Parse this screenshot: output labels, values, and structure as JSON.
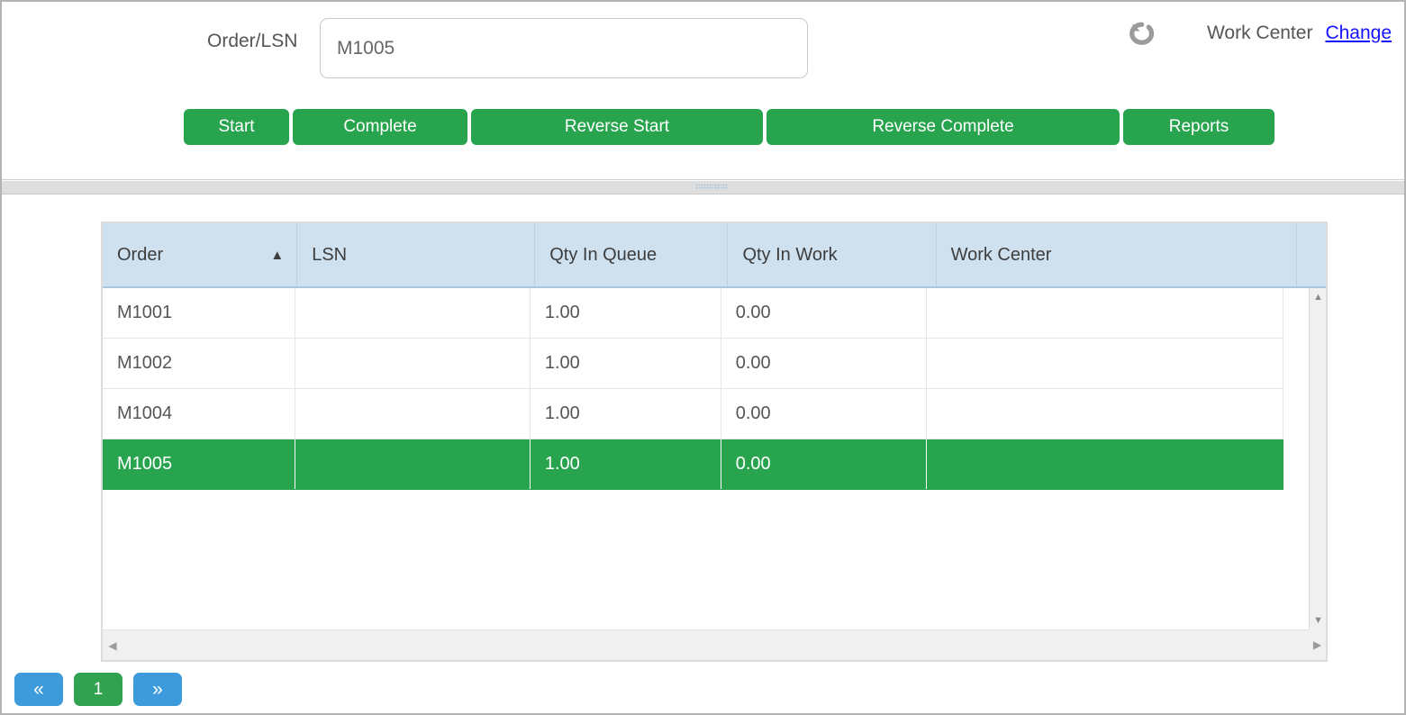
{
  "header": {
    "order_label": "Order/LSN",
    "order_value": "M1005",
    "order_placeholder": "",
    "undo_icon": "undo-arrow-icon",
    "work_center_label": "Work Center",
    "change_link": "Change"
  },
  "actions": {
    "start": "Start",
    "complete": "Complete",
    "reverse_start": "Reverse Start",
    "reverse_complete": "Reverse Complete",
    "reports": "Reports"
  },
  "grid": {
    "columns": [
      {
        "key": "order",
        "label": "Order",
        "sort": "asc"
      },
      {
        "key": "lsn",
        "label": "LSN",
        "sort": ""
      },
      {
        "key": "qty_queue",
        "label": "Qty In Queue",
        "sort": ""
      },
      {
        "key": "qty_work",
        "label": "Qty In Work",
        "sort": ""
      },
      {
        "key": "work_center",
        "label": "Work Center",
        "sort": ""
      },
      {
        "key": "spacer",
        "label": "",
        "sort": ""
      }
    ],
    "sort_caret_asc": "▲",
    "rows": [
      {
        "order": "M1001",
        "lsn": "",
        "qty_queue": "1.00",
        "qty_work": "0.00",
        "work_center": "",
        "selected": false
      },
      {
        "order": "M1002",
        "lsn": "",
        "qty_queue": "1.00",
        "qty_work": "0.00",
        "work_center": "",
        "selected": false
      },
      {
        "order": "M1004",
        "lsn": "",
        "qty_queue": "1.00",
        "qty_work": "0.00",
        "work_center": "",
        "selected": false
      },
      {
        "order": "M1005",
        "lsn": "",
        "qty_queue": "1.00",
        "qty_work": "0.00",
        "work_center": "",
        "selected": true
      }
    ]
  },
  "scrollbars": {
    "v_up_icon": "▲",
    "v_down_icon": "▼",
    "h_left_icon": "◀",
    "h_right_icon": "▶"
  },
  "pager": {
    "first_label": "«",
    "current_page": "1",
    "last_label": "»"
  },
  "colors": {
    "green": "#28a44f",
    "pager_blue": "#3d9bdc",
    "header_blue": "#cfe0ef",
    "link_blue": "#1414ff"
  }
}
